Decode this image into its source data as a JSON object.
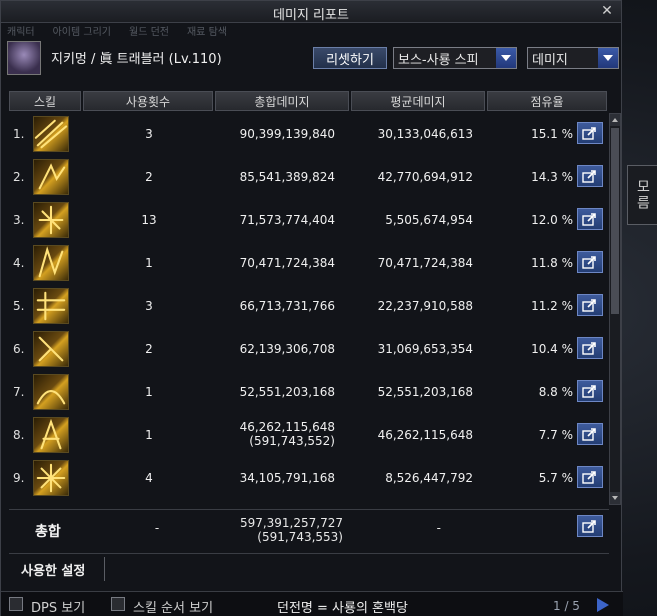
{
  "window": {
    "title": "데미지 리포트",
    "close_glyph": "✕",
    "faded_tabs": [
      "캐릭터",
      "아이템 그리기",
      "월드 던전",
      "재료 탐색"
    ]
  },
  "header": {
    "character": "지키멍 / 眞 트래블러 (Lv.110)",
    "reset_label": "리셋하기",
    "boss_select_value": "보스-사룡 스피",
    "damage_select_value": "데미지"
  },
  "columns": {
    "skill": "스킬",
    "count": "사용횟수",
    "total": "총합데미지",
    "avg": "평균데미지",
    "share": "점유율"
  },
  "rows": [
    {
      "rank": "1.",
      "count": "3",
      "total": "90,399,139,840",
      "total_sub": "",
      "avg": "30,133,046,613",
      "share": "15.1 %"
    },
    {
      "rank": "2.",
      "count": "2",
      "total": "85,541,389,824",
      "total_sub": "",
      "avg": "42,770,694,912",
      "share": "14.3 %"
    },
    {
      "rank": "3.",
      "count": "13",
      "total": "71,573,774,404",
      "total_sub": "",
      "avg": "5,505,674,954",
      "share": "12.0 %"
    },
    {
      "rank": "4.",
      "count": "1",
      "total": "70,471,724,384",
      "total_sub": "",
      "avg": "70,471,724,384",
      "share": "11.8 %"
    },
    {
      "rank": "5.",
      "count": "3",
      "total": "66,713,731,766",
      "total_sub": "",
      "avg": "22,237,910,588",
      "share": "11.2 %"
    },
    {
      "rank": "6.",
      "count": "2",
      "total": "62,139,306,708",
      "total_sub": "",
      "avg": "31,069,653,354",
      "share": "10.4 %"
    },
    {
      "rank": "7.",
      "count": "1",
      "total": "52,551,203,168",
      "total_sub": "",
      "avg": "52,551,203,168",
      "share": "8.8 %"
    },
    {
      "rank": "8.",
      "count": "1",
      "total": "46,262,115,648",
      "total_sub": "(591,743,552)",
      "avg": "46,262,115,648",
      "share": "7.7 %"
    },
    {
      "rank": "9.",
      "count": "4",
      "total": "34,105,791,168",
      "total_sub": "",
      "avg": "8,526,447,792",
      "share": "5.7 %"
    }
  ],
  "totals": {
    "label": "총합",
    "count": "-",
    "total": "597,391,257,727",
    "total_sub": "(591,743,553)",
    "avg": "-"
  },
  "settings_tab": "사용한 설정",
  "footer": {
    "dps_label": "DPS 보기",
    "skill_order_label": "스킬 순서 보기",
    "dungeon": "던전명 = 사룡의 혼백당",
    "pager": "1 / 5"
  },
  "side_tab": "모름",
  "icons": {
    "share": "share-icon",
    "skill": "skill-icon"
  },
  "colors": {
    "accent_blue": "#3c64c8",
    "header_bg": "#2b2e35"
  }
}
